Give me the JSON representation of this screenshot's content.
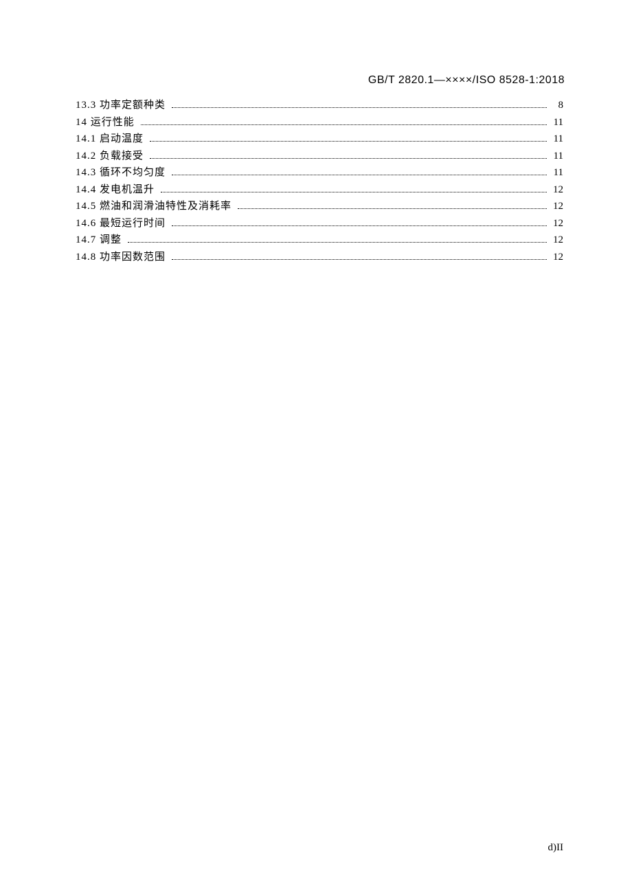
{
  "header": {
    "code": "GB/T 2820.1—××××/ISO 8528-1:2018"
  },
  "toc": {
    "entries": [
      {
        "num": "13.3",
        "title": "功率定额种类",
        "page": "8"
      },
      {
        "num": "14",
        "title": "运行性能",
        "page": "11"
      },
      {
        "num": "14.1",
        "title": "启动温度",
        "page": "11"
      },
      {
        "num": "14.2",
        "title": "负载接受",
        "page": "11"
      },
      {
        "num": "14.3",
        "title": "循环不均匀度",
        "page": "11"
      },
      {
        "num": "14.4",
        "title": "发电机温升",
        "page": "12"
      },
      {
        "num": "14.5",
        "title": "燃油和润滑油特性及消耗率",
        "page": "12"
      },
      {
        "num": "14.6",
        "title": "最短运行时间",
        "page": "12"
      },
      {
        "num": "14.7",
        "title": "调整",
        "page": "12"
      },
      {
        "num": "14.8",
        "title": "功率因数范围",
        "page": "12"
      }
    ]
  },
  "footer": {
    "marker": "d)II"
  }
}
